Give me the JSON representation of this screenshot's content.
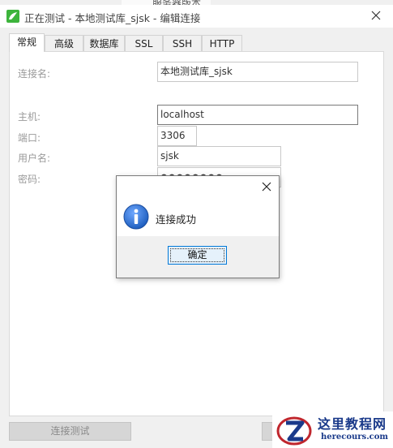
{
  "background_window": {
    "text": "服务器版本"
  },
  "window": {
    "title": "正在测试 - 本地测试库_sjsk - 编辑连接"
  },
  "tabs": [
    {
      "label": "常规",
      "active": true
    },
    {
      "label": "高级",
      "active": false
    },
    {
      "label": "数据库",
      "active": false
    },
    {
      "label": "SSL",
      "active": false
    },
    {
      "label": "SSH",
      "active": false
    },
    {
      "label": "HTTP",
      "active": false
    }
  ],
  "form": {
    "connection_name_label": "连接名:",
    "connection_name_value": "本地测试库_sjsk",
    "host_label": "主机:",
    "host_value": "localhost",
    "port_label": "端口:",
    "port_value": "3306",
    "username_label": "用户名:",
    "username_value": "sjsk",
    "password_label": "密码:",
    "password_value": "●●●●●●●●"
  },
  "buttons": {
    "test_connection": "连接测试"
  },
  "dialog": {
    "message": "连接成功",
    "ok_label": "确定"
  },
  "watermark": {
    "chinese": "这里教程网",
    "url": "herecours.com"
  },
  "colors": {
    "app_icon": "#3db43c",
    "info_icon": "#1f5fbf",
    "focus_border": "#0078d7",
    "watermark": "#1a3a8a"
  }
}
